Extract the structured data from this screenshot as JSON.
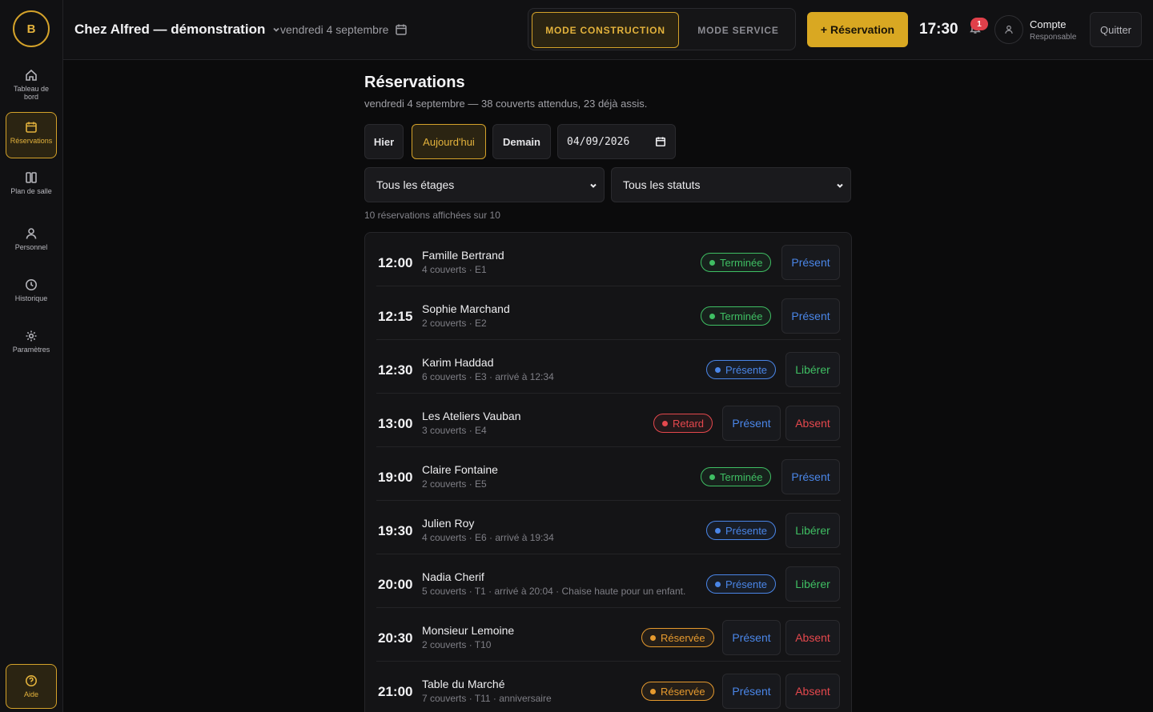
{
  "app": {
    "logo_letter": "B",
    "venue_name": "Chez Alfred — démonstration",
    "top_date": "vendredi 4 septembre",
    "mode_construction": "MODE CONSTRUCTION",
    "mode_service": "MODE SERVICE",
    "new_reservation": "+ Réservation",
    "clock": "17:30",
    "notification_count": "1",
    "account_name": "Compte",
    "account_role": "Responsable",
    "quit": "Quitter"
  },
  "sidebar": {
    "items": [
      {
        "label": "Tableau de bord",
        "icon": "home-icon"
      },
      {
        "label": "Réservations",
        "icon": "calendar-icon"
      },
      {
        "label": "Plan de salle",
        "icon": "columns-icon"
      },
      {
        "label": "Personnel",
        "icon": "user-icon"
      },
      {
        "label": "Historique",
        "icon": "clock-icon"
      },
      {
        "label": "Paramètres",
        "icon": "gear-icon"
      }
    ],
    "help_label": "Aide"
  },
  "page": {
    "title": "Réservations",
    "subtitle": "vendredi 4 septembre — 38 couverts attendus, 23 déjà assis.",
    "day_buttons": {
      "yesterday": "Hier",
      "today": "Aujourd'hui",
      "tomorrow": "Demain"
    },
    "date_value": "04/09/2026",
    "floor_filter": "Tous les étages",
    "status_filter": "Tous les statuts",
    "count_text": "10 réservations affichées sur 10"
  },
  "colors": {
    "accent": "#d4a22a",
    "done": "#3fbf63",
    "present": "#4a86e8",
    "late": "#e5484d",
    "reserved": "#e69a2e"
  },
  "reservations": [
    {
      "time": "12:00",
      "name": "Famille Bertrand",
      "meta": "4 couverts · E1",
      "status": "Terminée",
      "kind": "done",
      "actions": [
        "Présent"
      ]
    },
    {
      "time": "12:15",
      "name": "Sophie Marchand",
      "meta": "2 couverts · E2",
      "status": "Terminée",
      "kind": "done",
      "actions": [
        "Présent"
      ]
    },
    {
      "time": "12:30",
      "name": "Karim Haddad",
      "meta": "6 couverts · E3 · arrivé à 12:34",
      "status": "Présente",
      "kind": "present",
      "actions": [
        "Libérer"
      ]
    },
    {
      "time": "13:00",
      "name": "Les Ateliers Vauban",
      "meta": "3 couverts · E4",
      "status": "Retard",
      "kind": "late",
      "actions": [
        "Présent",
        "Absent"
      ]
    },
    {
      "time": "19:00",
      "name": "Claire Fontaine",
      "meta": "2 couverts · E5",
      "status": "Terminée",
      "kind": "done",
      "actions": [
        "Présent"
      ]
    },
    {
      "time": "19:30",
      "name": "Julien Roy",
      "meta": "4 couverts · E6 · arrivé à 19:34",
      "status": "Présente",
      "kind": "present",
      "actions": [
        "Libérer"
      ]
    },
    {
      "time": "20:00",
      "name": "Nadia Cherif",
      "meta": "5 couverts · T1 · arrivé à 20:04 · Chaise haute pour un enfant.",
      "status": "Présente",
      "kind": "present",
      "actions": [
        "Libérer"
      ]
    },
    {
      "time": "20:30",
      "name": "Monsieur Lemoine",
      "meta": "2 couverts · T10",
      "status": "Réservée",
      "kind": "reserved",
      "actions": [
        "Présent",
        "Absent"
      ]
    },
    {
      "time": "21:00",
      "name": "Table du Marché",
      "meta": "7 couverts · T11 · anniversaire",
      "status": "Réservée",
      "kind": "reserved",
      "actions": [
        "Présent",
        "Absent"
      ]
    }
  ]
}
